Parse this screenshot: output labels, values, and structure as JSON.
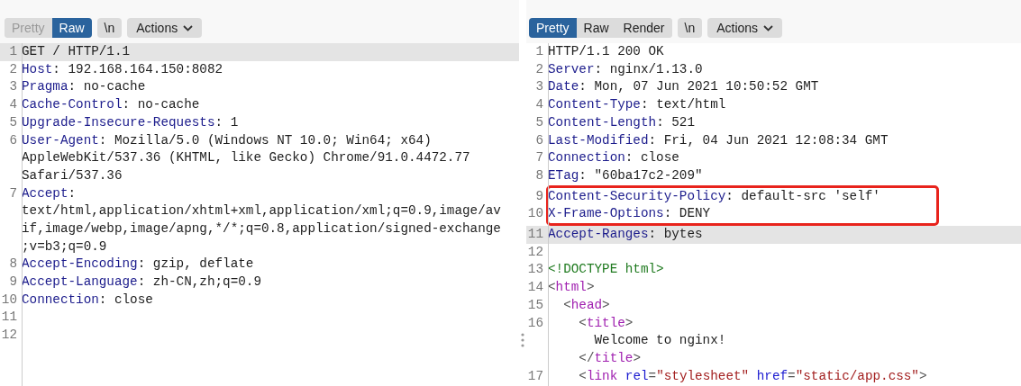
{
  "panes": [
    {
      "view_tabs": [
        {
          "label": "Pretty",
          "selected": false,
          "disabled": true
        },
        {
          "label": "Raw",
          "selected": true,
          "disabled": false
        }
      ],
      "newline_button": "\\n",
      "actions_button": "Actions",
      "lines": [
        {
          "number": "1",
          "highlighted": true,
          "boxed": false,
          "rows": [
            [
              {
                "kind": "text",
                "text": "GET / HTTP/1.1"
              }
            ]
          ]
        },
        {
          "number": "2",
          "highlighted": false,
          "boxed": false,
          "rows": [
            [
              {
                "kind": "key",
                "text": "Host"
              },
              {
                "kind": "text",
                "text": ": 192.168.164.150:8082"
              }
            ]
          ]
        },
        {
          "number": "3",
          "highlighted": false,
          "boxed": false,
          "rows": [
            [
              {
                "kind": "key",
                "text": "Pragma"
              },
              {
                "kind": "text",
                "text": ": no-cache"
              }
            ]
          ]
        },
        {
          "number": "4",
          "highlighted": false,
          "boxed": false,
          "rows": [
            [
              {
                "kind": "key",
                "text": "Cache-Control"
              },
              {
                "kind": "text",
                "text": ": no-cache"
              }
            ]
          ]
        },
        {
          "number": "5",
          "highlighted": false,
          "boxed": false,
          "rows": [
            [
              {
                "kind": "key",
                "text": "Upgrade-Insecure-Requests"
              },
              {
                "kind": "text",
                "text": ": 1"
              }
            ]
          ]
        },
        {
          "number": "6",
          "highlighted": false,
          "boxed": false,
          "rows": [
            [
              {
                "kind": "key",
                "text": "User-Agent"
              },
              {
                "kind": "text",
                "text": ": Mozilla/5.0 (Windows NT 10.0; Win64; x64)"
              }
            ],
            [
              {
                "kind": "text",
                "text": "AppleWebKit/537.36 (KHTML, like Gecko) Chrome/91.0.4472.77"
              }
            ],
            [
              {
                "kind": "text",
                "text": "Safari/537.36"
              }
            ]
          ]
        },
        {
          "number": "7",
          "highlighted": false,
          "boxed": false,
          "rows": [
            [
              {
                "kind": "key",
                "text": "Accept"
              },
              {
                "kind": "text",
                "text": ":"
              }
            ],
            [
              {
                "kind": "text",
                "text": "text/html,application/xhtml+xml,application/xml;q=0.9,image/av"
              }
            ],
            [
              {
                "kind": "text",
                "text": "if,image/webp,image/apng,*/*;q=0.8,application/signed-exchange"
              }
            ],
            [
              {
                "kind": "text",
                "text": ";v=b3;q=0.9"
              }
            ]
          ]
        },
        {
          "number": "8",
          "highlighted": false,
          "boxed": false,
          "rows": [
            [
              {
                "kind": "key",
                "text": "Accept-Encoding"
              },
              {
                "kind": "text",
                "text": ": gzip, deflate"
              }
            ]
          ]
        },
        {
          "number": "9",
          "highlighted": false,
          "boxed": false,
          "rows": [
            [
              {
                "kind": "key",
                "text": "Accept-Language"
              },
              {
                "kind": "text",
                "text": ": zh-CN,zh;q=0.9"
              }
            ]
          ]
        },
        {
          "number": "10",
          "highlighted": false,
          "boxed": false,
          "rows": [
            [
              {
                "kind": "key",
                "text": "Connection"
              },
              {
                "kind": "text",
                "text": ": close"
              }
            ]
          ]
        },
        {
          "number": "11",
          "highlighted": false,
          "boxed": false
        },
        {
          "number": "12",
          "highlighted": false,
          "boxed": false
        }
      ]
    },
    {
      "view_tabs": [
        {
          "label": "Pretty",
          "selected": true,
          "disabled": false
        },
        {
          "label": "Raw",
          "selected": false,
          "disabled": false
        },
        {
          "label": "Render",
          "selected": false,
          "disabled": false
        }
      ],
      "newline_button": "\\n",
      "actions_button": "Actions",
      "lines": [
        {
          "number": "1",
          "highlighted": false,
          "boxed": false,
          "rows": [
            [
              {
                "kind": "text",
                "text": "HTTP/1.1 200 OK"
              }
            ]
          ]
        },
        {
          "number": "2",
          "highlighted": false,
          "boxed": false,
          "rows": [
            [
              {
                "kind": "key",
                "text": "Server"
              },
              {
                "kind": "text",
                "text": ": nginx/1.13.0"
              }
            ]
          ]
        },
        {
          "number": "3",
          "highlighted": false,
          "boxed": false,
          "rows": [
            [
              {
                "kind": "key",
                "text": "Date"
              },
              {
                "kind": "text",
                "text": ": Mon, 07 Jun 2021 10:50:52 GMT"
              }
            ]
          ]
        },
        {
          "number": "4",
          "highlighted": false,
          "boxed": false,
          "rows": [
            [
              {
                "kind": "key",
                "text": "Content-Type"
              },
              {
                "kind": "text",
                "text": ": text/html"
              }
            ]
          ]
        },
        {
          "number": "5",
          "highlighted": false,
          "boxed": false,
          "rows": [
            [
              {
                "kind": "key",
                "text": "Content-Length"
              },
              {
                "kind": "text",
                "text": ": 521"
              }
            ]
          ]
        },
        {
          "number": "6",
          "highlighted": false,
          "boxed": false,
          "rows": [
            [
              {
                "kind": "key",
                "text": "Last-Modified"
              },
              {
                "kind": "text",
                "text": ": Fri, 04 Jun 2021 12:08:34 GMT"
              }
            ]
          ]
        },
        {
          "number": "7",
          "highlighted": false,
          "boxed": false,
          "rows": [
            [
              {
                "kind": "key",
                "text": "Connection"
              },
              {
                "kind": "text",
                "text": ": close"
              }
            ]
          ]
        },
        {
          "number": "8",
          "highlighted": false,
          "boxed": false,
          "rows": [
            [
              {
                "kind": "key",
                "text": "ETag"
              },
              {
                "kind": "text",
                "text": ": \"60ba17c2-209\""
              }
            ]
          ]
        },
        {
          "number": "9",
          "highlighted": false,
          "boxed": true,
          "rows": [
            [
              {
                "kind": "key",
                "text": "Content-Security-Policy"
              },
              {
                "kind": "text",
                "text": ": default-src 'self'"
              }
            ]
          ]
        },
        {
          "number": "10",
          "highlighted": false,
          "boxed": true,
          "rows": [
            [
              {
                "kind": "key",
                "text": "X-Frame-Options"
              },
              {
                "kind": "text",
                "text": ": DENY"
              }
            ]
          ]
        },
        {
          "number": "11",
          "highlighted": true,
          "boxed": false,
          "rows": [
            [
              {
                "kind": "key",
                "text": "Accept-Ranges"
              },
              {
                "kind": "text",
                "text": ": bytes"
              }
            ]
          ]
        },
        {
          "number": "12",
          "highlighted": false,
          "boxed": false
        },
        {
          "number": "13",
          "highlighted": false,
          "boxed": false,
          "rows": [
            [
              {
                "kind": "doctype",
                "text": "<!DOCTYPE html>"
              }
            ]
          ]
        },
        {
          "number": "14",
          "highlighted": false,
          "boxed": false,
          "rows": [
            [
              {
                "kind": "punct",
                "text": "<"
              },
              {
                "kind": "tag",
                "text": "html"
              },
              {
                "kind": "punct",
                "text": ">"
              }
            ]
          ]
        },
        {
          "number": "15",
          "highlighted": false,
          "boxed": false,
          "rows": [
            [
              {
                "kind": "text",
                "text": "  "
              },
              {
                "kind": "punct",
                "text": "<"
              },
              {
                "kind": "tag",
                "text": "head"
              },
              {
                "kind": "punct",
                "text": ">"
              }
            ]
          ]
        },
        {
          "number": "16",
          "highlighted": false,
          "boxed": false,
          "rows": [
            [
              {
                "kind": "text",
                "text": "    "
              },
              {
                "kind": "punct",
                "text": "<"
              },
              {
                "kind": "tag",
                "text": "title"
              },
              {
                "kind": "punct",
                "text": ">"
              }
            ],
            [
              {
                "kind": "text",
                "text": "      Welcome to nginx!"
              }
            ],
            [
              {
                "kind": "text",
                "text": "    "
              },
              {
                "kind": "punct",
                "text": "</"
              },
              {
                "kind": "tag",
                "text": "title"
              },
              {
                "kind": "punct",
                "text": ">"
              }
            ]
          ]
        },
        {
          "number": "17",
          "highlighted": false,
          "boxed": false,
          "rows": [
            [
              {
                "kind": "text",
                "text": "    "
              },
              {
                "kind": "punct",
                "text": "<"
              },
              {
                "kind": "tag",
                "text": "link"
              },
              {
                "kind": "text",
                "text": " "
              },
              {
                "kind": "attr",
                "text": "rel"
              },
              {
                "kind": "punct",
                "text": "="
              },
              {
                "kind": "string",
                "text": "\"stylesheet\""
              },
              {
                "kind": "text",
                "text": " "
              },
              {
                "kind": "attr",
                "text": "href"
              },
              {
                "kind": "punct",
                "text": "="
              },
              {
                "kind": "string",
                "text": "\"static/app.css\""
              },
              {
                "kind": "punct",
                "text": ">"
              }
            ]
          ]
        }
      ]
    }
  ]
}
